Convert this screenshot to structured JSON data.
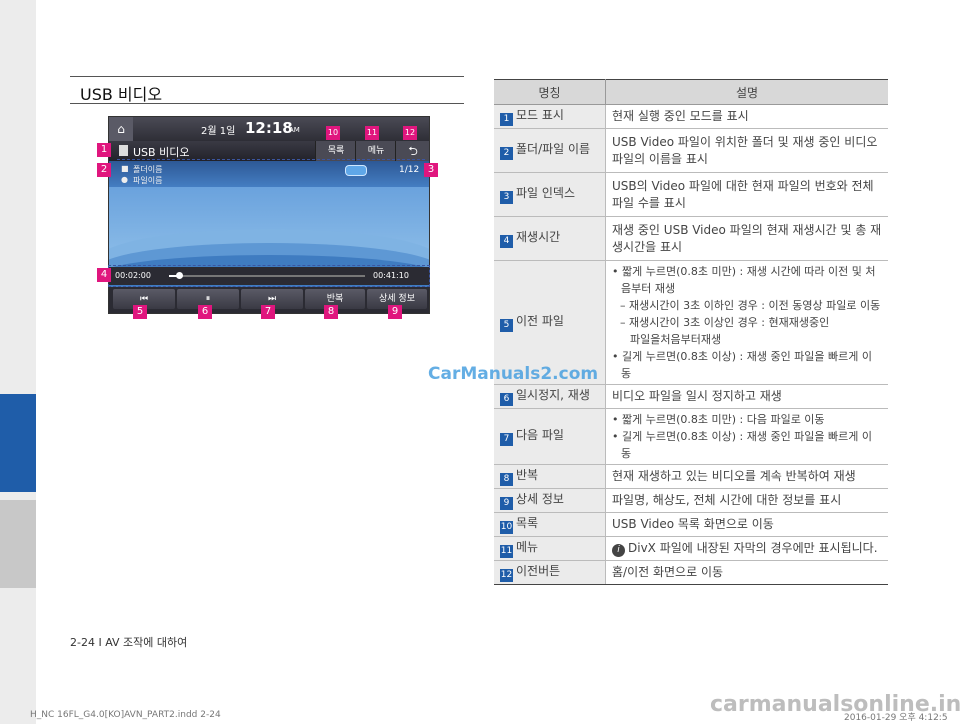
{
  "page_title": "USB 비디오",
  "screen": {
    "date": "2월  1일",
    "time": "12:18",
    "ampm": "AM",
    "title": "USB 비디오",
    "list_label": "목록",
    "menu_label": "메뉴",
    "back_symbol": "⮌",
    "folder_name": "폴더이름",
    "file_name": "파일이름",
    "index": "1/12",
    "time_elapsed": "00:02:00",
    "time_total": "00:41:10",
    "progress_fraction": 0.05,
    "prev_symbol": "⏮",
    "pause_symbol": "⏸",
    "next_symbol": "⏭",
    "repeat_label": "반복",
    "detail_label": "상세 정보"
  },
  "callouts": [
    "1",
    "2",
    "3",
    "4",
    "5",
    "6",
    "7",
    "8",
    "9",
    "10",
    "11",
    "12"
  ],
  "table": {
    "header_name": "명칭",
    "header_desc": "설명",
    "rows": [
      {
        "num": "1",
        "name": "모드 표시",
        "desc": "현재 실행 중인 모드를 표시"
      },
      {
        "num": "2",
        "name": "폴더/파일 이름",
        "desc": "USB Video 파일이 위치한 폴더 및 재생 중인 비디오 파일의 이름을 표시"
      },
      {
        "num": "3",
        "name": "파일 인덱스",
        "desc": "USB의 Video 파일에 대한 현재 파일의 번호와 전체 파일 수를 표시"
      },
      {
        "num": "4",
        "name": "재생시간",
        "desc": "재생 중인 USB Video 파일의 현재 재생시간 및 총 재생시간을 표시"
      },
      {
        "num": "5",
        "name": "이전 파일",
        "b1": "• 짧게 누르면(0.8초 미만) : 재생 시간에 따라 이전 및 처음부터 재생",
        "s1": "– 재생시간이 3초 이하인 경우 : 이전 동영상 파일로 이동",
        "s2": "– 재생시간이 3초 이상인 경우 : 현재재생중인",
        "s3": "파일을처음부터재생",
        "b2": "• 길게 누르면(0.8초 이상) : 재생 중인 파일을 빠르게 이동"
      },
      {
        "num": "6",
        "name": "일시정지, 재생",
        "desc": "비디오 파일을 일시 정지하고 재생"
      },
      {
        "num": "7",
        "name": "다음 파일",
        "b1": "• 짧게 누르면(0.8초 미만) : 다음 파일로 이동",
        "b2": "• 길게 누르면(0.8초 이상) : 재생 중인 파일을 빠르게 이동"
      },
      {
        "num": "8",
        "name": "반복",
        "desc": "현재 재생하고 있는 비디오를 계속 반복하여 재생"
      },
      {
        "num": "9",
        "name": "상세 정보",
        "desc": "파일명, 해상도, 전체 시간에 대한 정보를 표시"
      },
      {
        "num": "10",
        "name": "목록",
        "desc": "USB Video 목록 화면으로 이동"
      },
      {
        "num": "11",
        "name": "메뉴",
        "info": "i",
        "desc": "DivX 파일에 내장된 자막의 경우에만 표시됩니다."
      },
      {
        "num": "12",
        "name": "이전버튼",
        "desc": "홈/이전 화면으로 이동"
      }
    ]
  },
  "watermark": "CarManuals2.com",
  "footer": "2-24 I AV 조작에 대하여",
  "slug_left": "H_NC 16FL_G4.0[KO]AVN_PART2.indd   2-24",
  "slug_right": "2016-01-29   오후 4:12:5",
  "bottom_watermark": "carmanualsonline.info"
}
